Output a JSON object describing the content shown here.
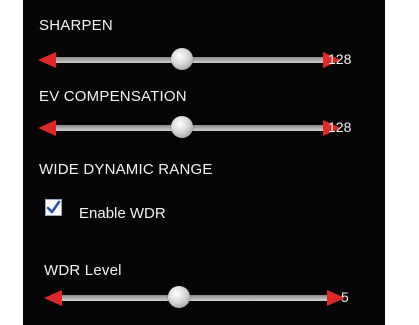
{
  "sharpen": {
    "label": "SHARPEN",
    "value": "128",
    "fraction": 0.5
  },
  "ev_compensation": {
    "label": "EV COMPENSATION",
    "value": "128",
    "fraction": 0.5
  },
  "wdr": {
    "section_label": "WIDE DYNAMIC RANGE",
    "enable_label": "Enable WDR",
    "enabled": true,
    "level_label": "WDR Level",
    "level_value": "5",
    "level_fraction": 0.5
  },
  "colors": {
    "panel_bg": "#050505",
    "arrow": "#e02828",
    "checkmark": "#2b50a8"
  },
  "icons": {
    "slider_left": "left-arrow-icon",
    "slider_right": "right-arrow-icon",
    "check": "checkmark-icon"
  }
}
